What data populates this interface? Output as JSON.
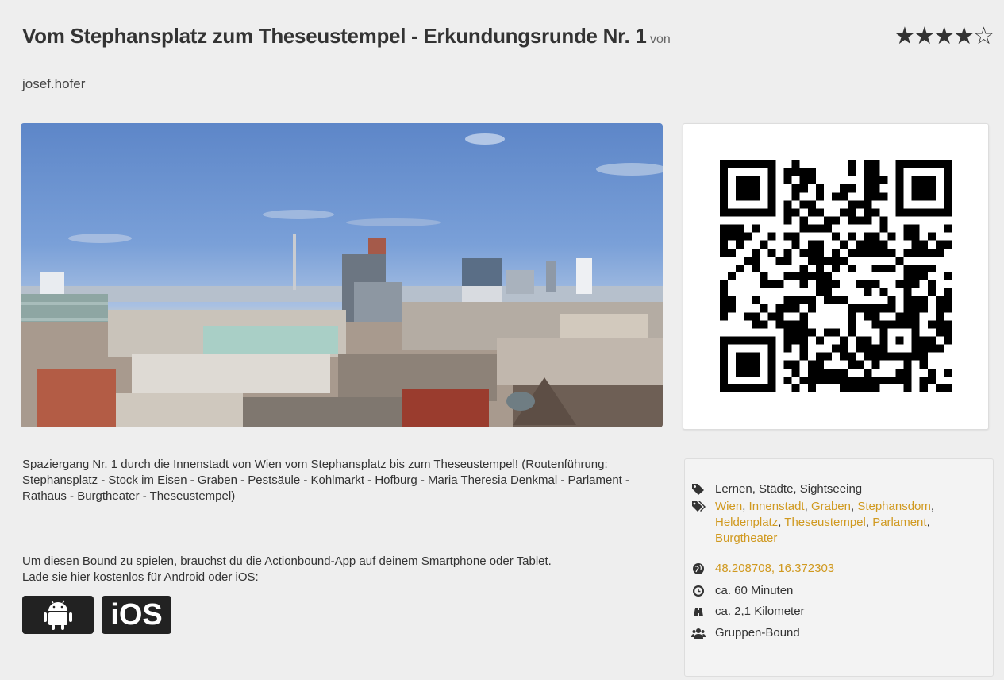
{
  "header": {
    "title": "Vom Stephansplatz zum Theseustempel - Erkundungsrunde Nr. 1",
    "by_label": "von",
    "author": "josef.hofer",
    "rating_stars": 4,
    "rating_max": 5
  },
  "description": "Spaziergang Nr. 1 durch die Innenstadt von Wien vom Stephansplatz bis zum Theseustempel! (Routenführung: Stephansplatz - Stock im Eisen - Graben - Pestsäule - Kohlmarkt - Hofburg - Maria Theresia Denkmal - Parlament - Rathaus - Burgtheater - Theseustempel)",
  "play_line1": "Um diesen Bound zu spielen, brauchst du die Actionbound-App auf deinem Smartphone oder Tablet.",
  "play_line2": "Lade sie hier kostenlos für Android oder iOS:",
  "stores": {
    "ios_label": "iOS"
  },
  "info": {
    "categories": "Lernen, Städte, Sightseeing",
    "tags": [
      "Wien",
      "Innenstadt",
      "Graben",
      "Stephansdom",
      "Heldenplatz",
      "Theseustempel",
      "Parlament",
      "Burgtheater"
    ],
    "coordinates": "48.208708, 16.372303",
    "duration": "ca. 60 Minuten",
    "distance": "ca. 2,1 Kilometer",
    "mode": "Gruppen-Bound"
  },
  "colors": {
    "link": "#d0991f",
    "button_bg": "#222222"
  },
  "icons": {
    "category": "tag-icon",
    "tags": "tags-icon",
    "location": "globe-icon",
    "time": "clock-icon",
    "distance": "binoculars-icon",
    "mode": "group-icon"
  }
}
